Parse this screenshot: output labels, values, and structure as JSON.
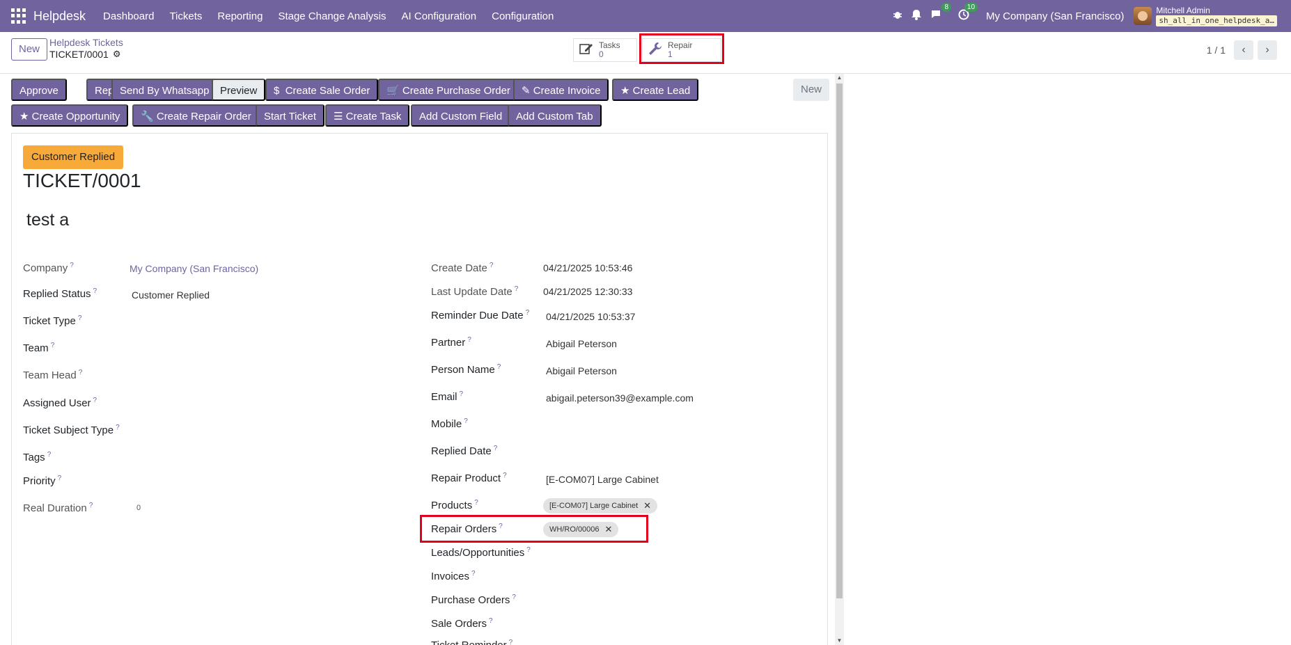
{
  "navbar": {
    "brand": "Helpdesk",
    "menu": [
      "Dashboard",
      "Tickets",
      "Reporting",
      "Stage Change Analysis",
      "AI Configuration",
      "Configuration"
    ],
    "messages_badge": "8",
    "activities_badge": "10",
    "company": "My Company (San Francisco)",
    "user_name": "Mitchell Admin",
    "db_name": "sh_all_in_one_helpdesk_a…"
  },
  "control_panel": {
    "new_label": "New",
    "breadcrumb_parent": "Helpdesk Tickets",
    "breadcrumb_current": "TICKET/0001",
    "smart_buttons": {
      "tasks": {
        "label": "Tasks",
        "count": "0"
      },
      "repair": {
        "label": "Repair",
        "count": "1"
      }
    },
    "pager": "1 / 1"
  },
  "header_buttons": {
    "approve": "Approve",
    "reply": "Reply",
    "whatsapp": "Send By Whatsapp",
    "preview": "Preview",
    "sale_order": "Create Sale Order",
    "purchase_order": "Create Purchase Order",
    "invoice": "Create Invoice",
    "lead": "Create Lead",
    "opportunity": "Create Opportunity",
    "repair_order": "Create Repair Order",
    "start_ticket": "Start Ticket",
    "task": "Create Task",
    "custom_field": "Add Custom Field",
    "custom_tab": "Add Custom Tab",
    "stage": "New"
  },
  "form": {
    "status_badge": "Customer Replied",
    "ticket_name": "TICKET/0001",
    "subject": "test a",
    "left": {
      "company": {
        "label": "Company",
        "value": "My Company (San Francisco)"
      },
      "replied_status": {
        "label": "Replied Status",
        "value": "Customer Replied"
      },
      "ticket_type": {
        "label": "Ticket Type"
      },
      "team": {
        "label": "Team"
      },
      "team_head": {
        "label": "Team Head"
      },
      "assigned_user": {
        "label": "Assigned User"
      },
      "subject_type": {
        "label": "Ticket Subject Type"
      },
      "tags": {
        "label": "Tags"
      },
      "priority": {
        "label": "Priority"
      },
      "real_duration": {
        "label": "Real Duration",
        "value": "0"
      }
    },
    "right": {
      "create_date": {
        "label": "Create Date",
        "value": "04/21/2025 10:53:46"
      },
      "last_update": {
        "label": "Last Update Date",
        "value": "04/21/2025 12:30:33"
      },
      "reminder_due": {
        "label": "Reminder Due Date",
        "value": "04/21/2025 10:53:37"
      },
      "partner": {
        "label": "Partner",
        "value": "Abigail Peterson"
      },
      "person_name": {
        "label": "Person Name",
        "value": "Abigail Peterson"
      },
      "email": {
        "label": "Email",
        "value": "abigail.peterson39@example.com"
      },
      "mobile": {
        "label": "Mobile"
      },
      "replied_date": {
        "label": "Replied Date"
      },
      "repair_product": {
        "label": "Repair Product",
        "value": "[E-COM07] Large Cabinet"
      },
      "products": {
        "label": "Products",
        "tag": "[E-COM07] Large Cabinet"
      },
      "repair_orders": {
        "label": "Repair Orders",
        "tag": "WH/RO/00006"
      },
      "leads": {
        "label": "Leads/Opportunities"
      },
      "invoices": {
        "label": "Invoices"
      },
      "purchase_orders": {
        "label": "Purchase Orders"
      },
      "sale_orders": {
        "label": "Sale Orders"
      },
      "ticket_reminder": {
        "label": "Ticket Reminder"
      }
    },
    "help_mark": "?"
  }
}
